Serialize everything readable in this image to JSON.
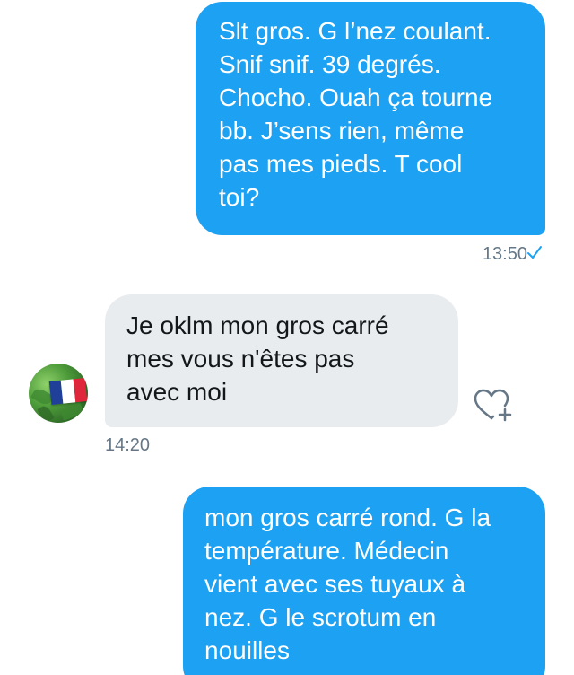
{
  "messages": [
    {
      "direction": "sent",
      "text": "Slt gros. G l’nez coulant.\nSnif snif. 39 degrés.\nChocho. Ouah ça tourne\nbb. J’sens rien, même\npas mes pieds. T cool\ntoi?",
      "time": "13:50",
      "status_icon": "check-icon"
    },
    {
      "direction": "received",
      "text": "Je oklm  mon gros carré\nmes  vous  n'êtes  pas\navec moi",
      "time": "14:20",
      "reaction_icon": "heart-plus-icon"
    },
    {
      "direction": "sent",
      "text": "mon gros carré rond. G la\ntempérature. Médecin\nvient avec ses tuyaux à\nnez. G le scrotum en\nnouilles"
    }
  ],
  "contact": {
    "avatar_icon": "france-flag-icon"
  },
  "colors": {
    "sent_bubble": "#1da1f2",
    "received_bubble": "#e9ecef",
    "meta_text": "#657786",
    "check": "#1da1f2"
  }
}
